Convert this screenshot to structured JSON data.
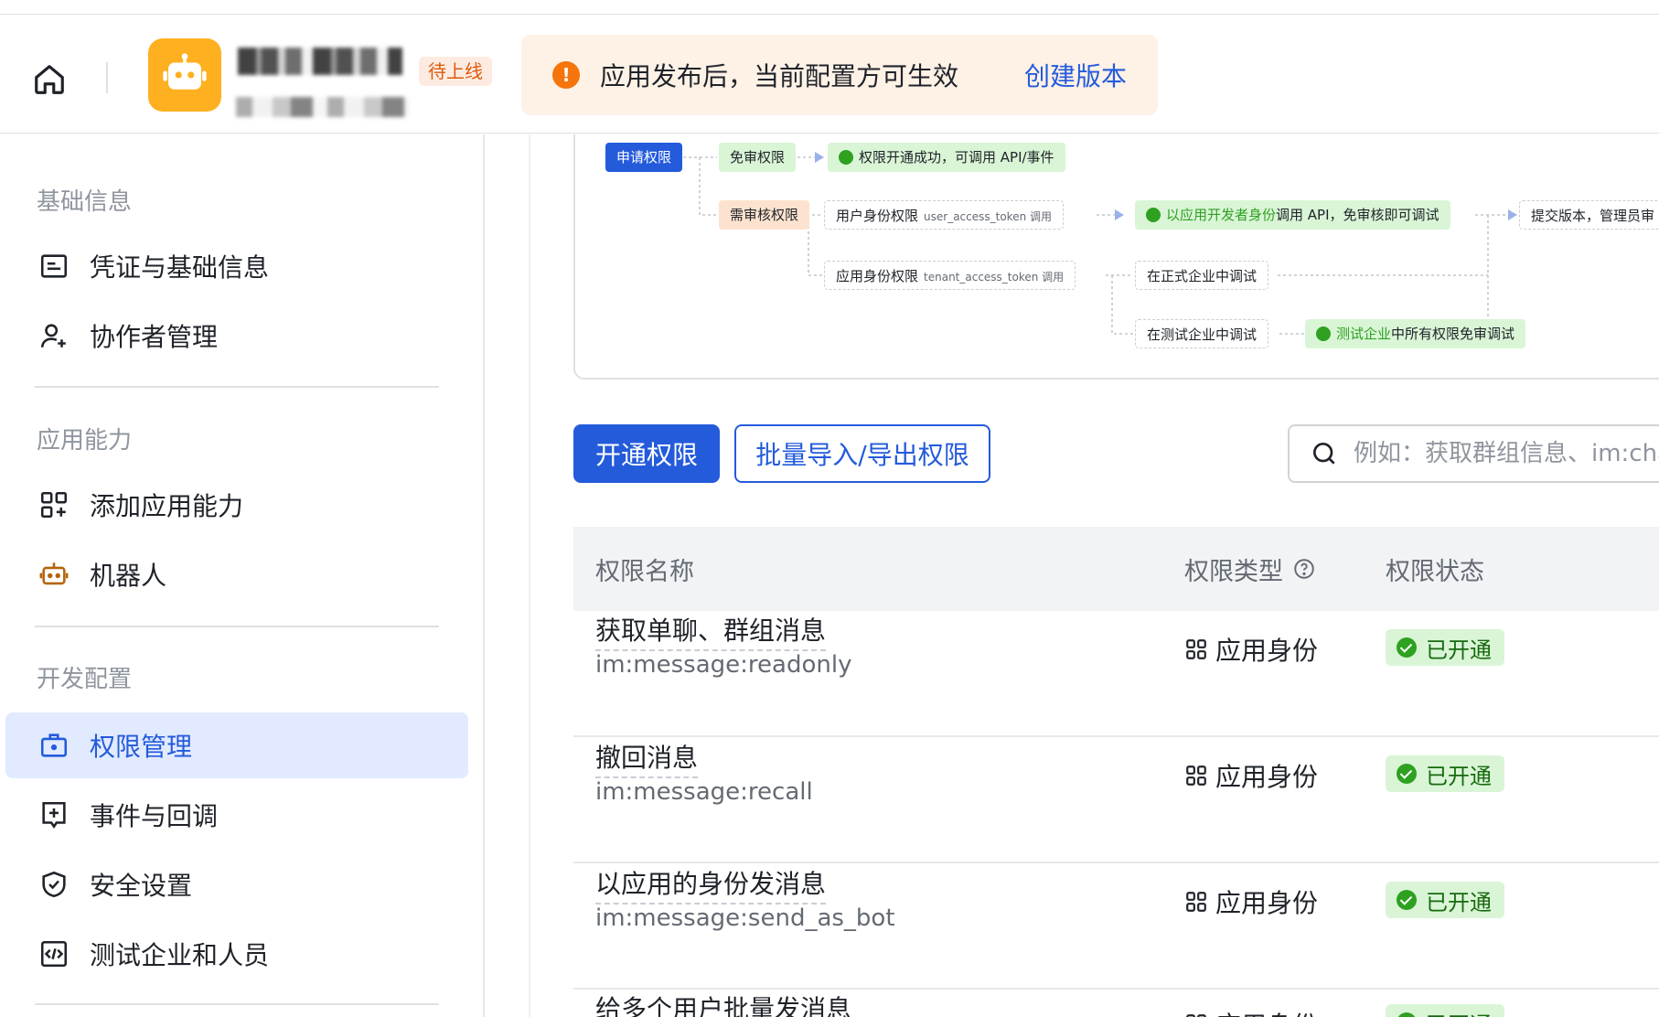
{
  "header": {
    "pending_tag": "待上线",
    "notice_text": "应用发布后，当前配置方可生效",
    "notice_link": "创建版本"
  },
  "sidebar": {
    "sections": [
      {
        "title": "基础信息",
        "items": [
          "凭证与基础信息",
          "协作者管理"
        ]
      },
      {
        "title": "应用能力",
        "items": [
          "添加应用能力",
          "机器人"
        ]
      },
      {
        "title": "开发配置",
        "items": [
          "权限管理",
          "事件与回调",
          "安全设置",
          "测试企业和人员"
        ]
      }
    ],
    "active_item": "权限管理"
  },
  "diagram": {
    "apply": "申请权限",
    "free": "免审权限",
    "free_result": "权限开通成功，可调用 API/事件",
    "review": "需审核权限",
    "user_perm": "用户身份权限",
    "user_perm_note": "user_access_token 调用",
    "tenant_perm": "应用身份权限",
    "tenant_perm_note": "tenant_access_token 调用",
    "dev_debug_a": "以应用开发者身份",
    "dev_debug_b": "调用 API，免审核即可调试",
    "submit": "提交版本，管理员审",
    "prod_debug": "在正式企业中调试",
    "test_debug": "在测试企业中调试",
    "test_result_a": "测试企业",
    "test_result_b": "中所有权限免审调试"
  },
  "toolbar": {
    "primary": "开通权限",
    "secondary": "批量导入/导出权限",
    "search_placeholder": "例如：获取群组信息、im:chat"
  },
  "table": {
    "headers": [
      "权限名称",
      "权限类型",
      "权限状态"
    ],
    "rows": [
      {
        "name": "获取单聊、群组消息",
        "code": "im:message:readonly",
        "type": "应用身份",
        "status": "已开通"
      },
      {
        "name": "撤回消息",
        "code": "im:message:recall",
        "type": "应用身份",
        "status": "已开通"
      },
      {
        "name": "以应用的身份发消息",
        "code": "im:message:send_as_bot",
        "type": "应用身份",
        "status": "已开通"
      },
      {
        "name": "给多个用户批量发消息",
        "code": "",
        "type": "应用身份",
        "status": "已开通"
      }
    ]
  },
  "colors": {
    "accent": "#245bdb",
    "success": "#2ea121",
    "warning": "#f5740b",
    "app_icon": "#ffb020"
  }
}
